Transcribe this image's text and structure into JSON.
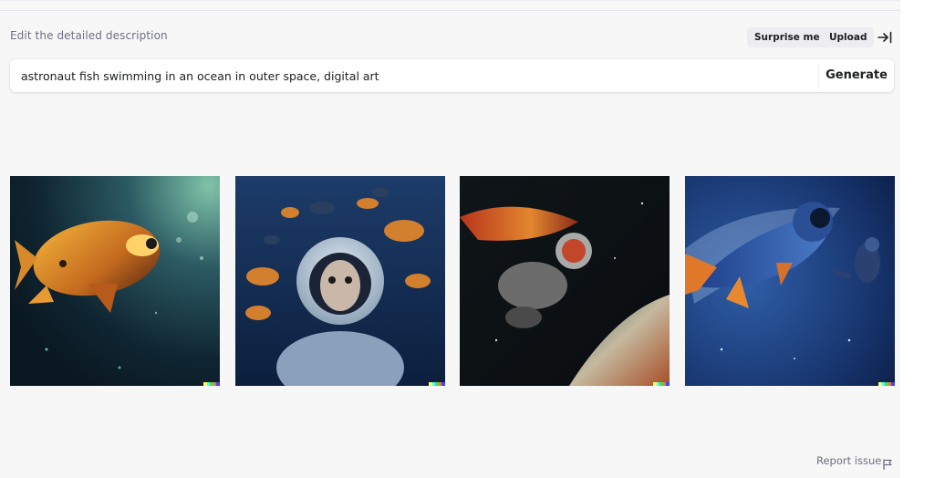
{
  "editor": {
    "label": "Edit the detailed description",
    "surprise_label": "Surprise me",
    "upload_label": "Upload",
    "collapse_icon": "arrow-right-to-bar-icon",
    "prompt_value": "astronaut fish swimming in an ocean in outer space, digital art",
    "generate_label": "Generate"
  },
  "results": {
    "images": [
      {
        "name": "result-image-1"
      },
      {
        "name": "result-image-2"
      },
      {
        "name": "result-image-3"
      },
      {
        "name": "result-image-4"
      }
    ],
    "signature_colors": [
      "#ffff66",
      "#42ffff",
      "#51da4c",
      "#ff6e3c",
      "#3c46ff"
    ]
  },
  "footer": {
    "report_label": "Report issue",
    "report_icon": "flag-icon"
  },
  "colors": {
    "background": "#f7f7f8",
    "button_bg": "#ececf1",
    "muted_text": "#6e6e80",
    "text": "#202123"
  }
}
